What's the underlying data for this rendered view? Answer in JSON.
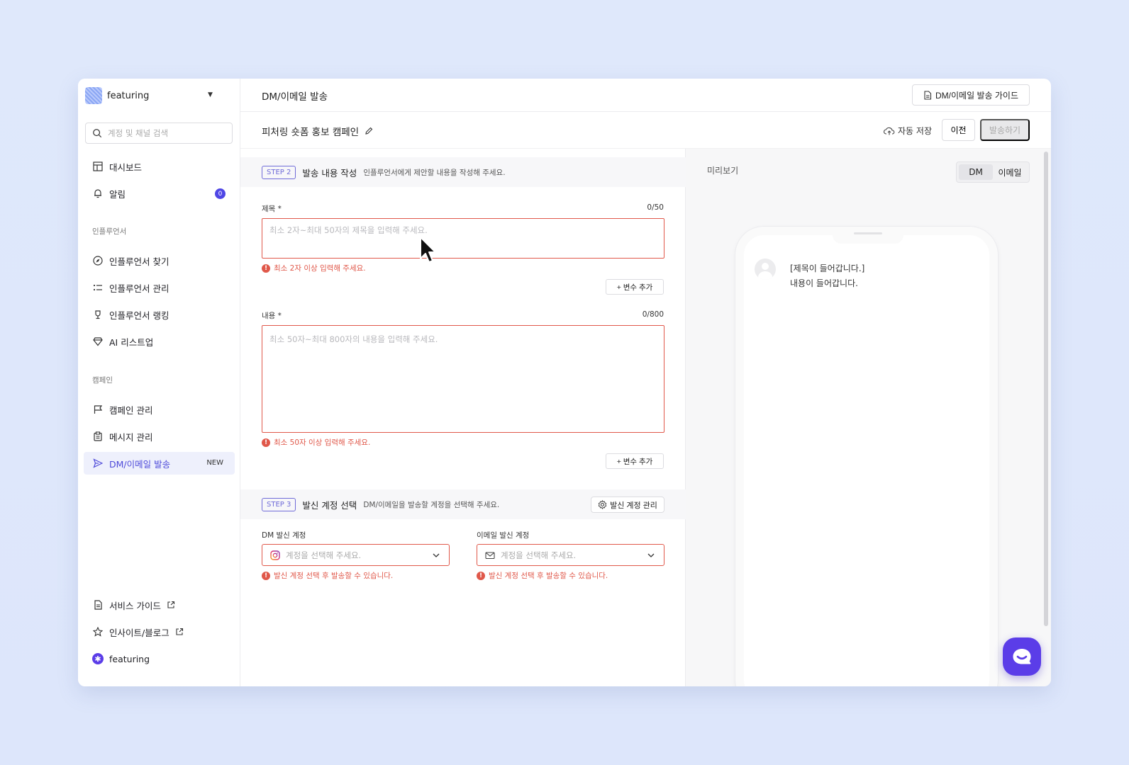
{
  "brand": {
    "name": "featuring"
  },
  "sidebar": {
    "search_placeholder": "계정 및 채널 검색",
    "dashboard": "대시보드",
    "alerts": "알림",
    "alerts_count": "0",
    "section_influencer": "인플루언서",
    "find_influencer": "인플루언서 찾기",
    "manage_influencer": "인플루언서 관리",
    "ranking": "인플루언서 랭킹",
    "ai_listup": "AI 리스트업",
    "section_campaign": "캠페인",
    "campaign_manage": "캠페인 관리",
    "message_manage": "메시지 관리",
    "dm_email": "DM/이메일 발송",
    "dm_email_badge": "NEW",
    "service_guide": "서비스 가이드",
    "insight_blog": "인사이트/블로그",
    "footer_brand": "featuring"
  },
  "topbar": {
    "title": "DM/이메일 발송",
    "guide_button": "DM/이메일 발송 가이드"
  },
  "campaign": {
    "title": "피처링 숏폼 홍보 캠페인",
    "autosave": "자동 저장",
    "prev_button": "이전",
    "send_button": "발송하기"
  },
  "step2": {
    "tag": "STEP 2",
    "title": "발송 내용 작성",
    "desc": "인플루언서에게 제안할 내용을 작성해 주세요.",
    "subject_label": "제목 *",
    "subject_count": "0/50",
    "subject_placeholder": "최소 2자~최대 50자의 제목을 입력해 주세요.",
    "subject_error": "최소 2자 이상 입력해 주세요.",
    "add_variable": "+ 변수 추가",
    "body_label": "내용 *",
    "body_count": "0/800",
    "body_placeholder": "최소 50자~최대 800자의 내용을 입력해 주세요.",
    "body_error": "최소 50자 이상 입력해 주세요."
  },
  "step3": {
    "tag": "STEP 3",
    "title": "발신 계정 선택",
    "desc": "DM/이메일을 발송할 계정을 선택해 주세요.",
    "manage_button": "발신 계정 관리",
    "dm_label": "DM 발신 계정",
    "email_label": "이메일 발신 계정",
    "select_placeholder": "계정을 선택해 주세요.",
    "select_error": "발신 계정 선택 후 발송할 수 있습니다."
  },
  "preview": {
    "label": "미리보기",
    "tab_dm": "DM",
    "tab_email": "이메일",
    "msg_title": "[제목이 들어갑니다.]",
    "msg_body": "내용이 들어갑니다."
  },
  "colors": {
    "accent": "#4f46e5",
    "error": "#e0584a",
    "chat_button": "#5b3de8"
  }
}
